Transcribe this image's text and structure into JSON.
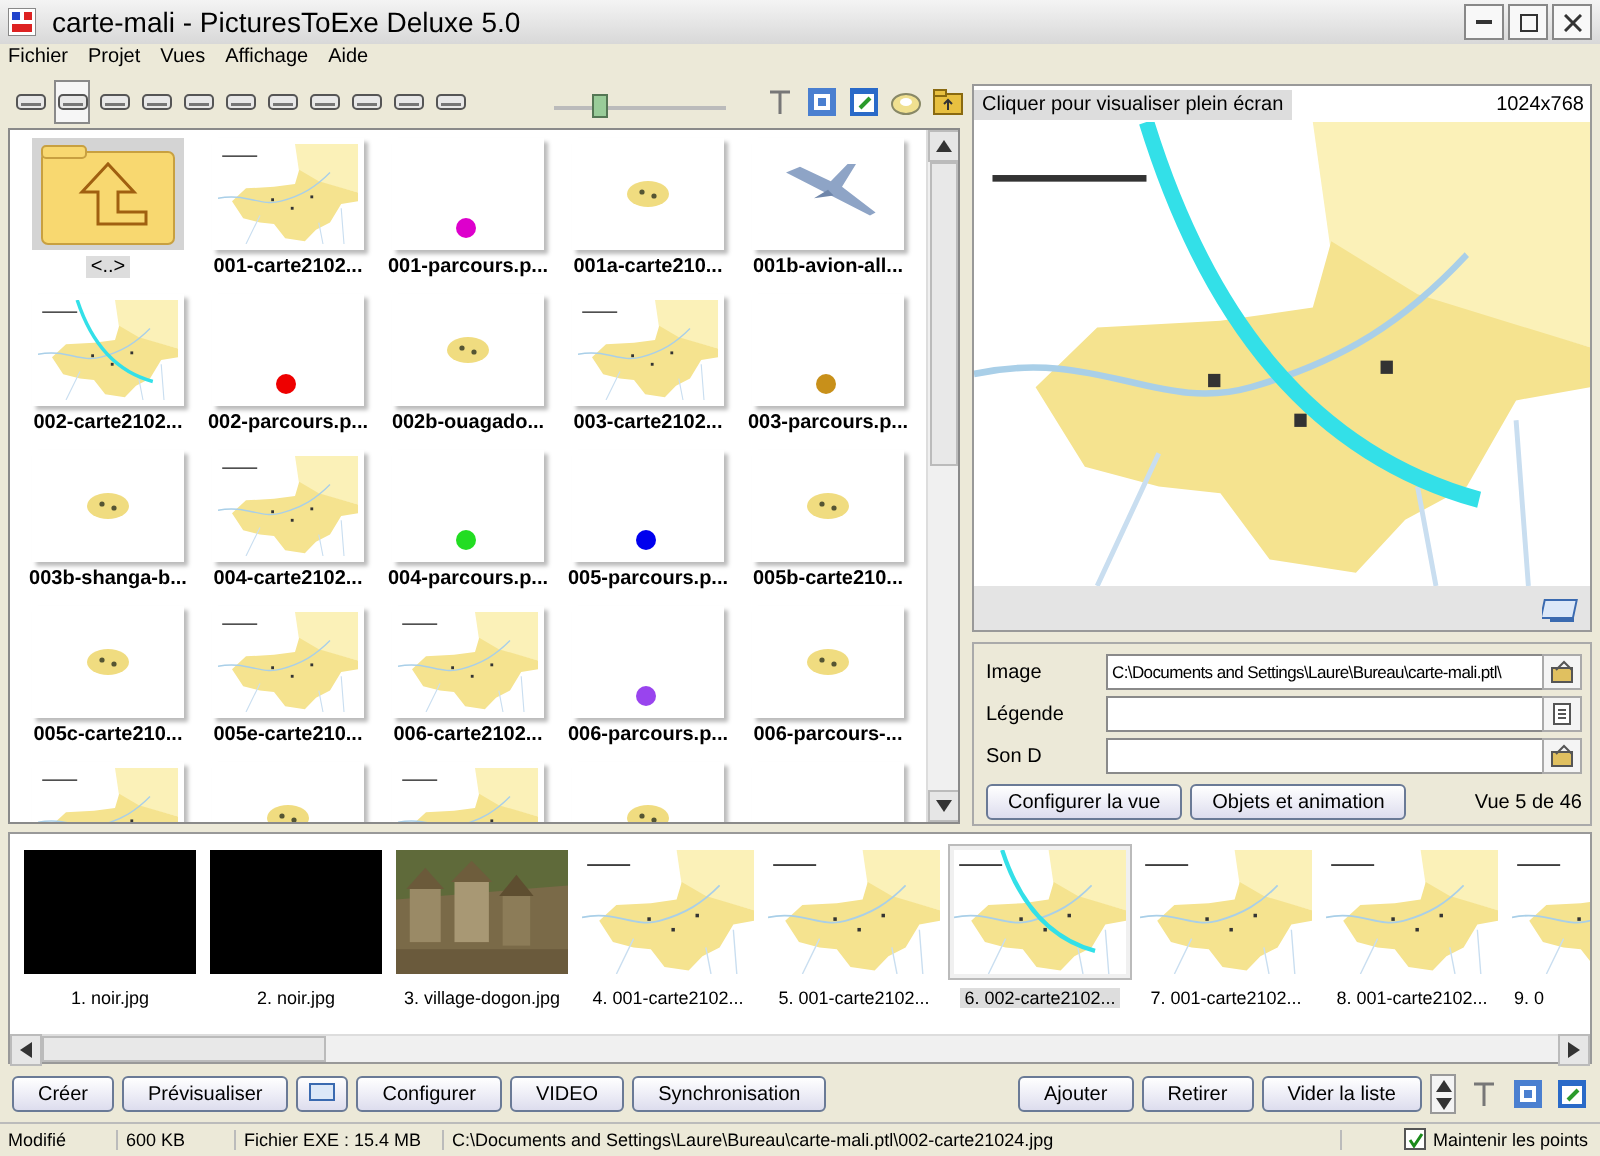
{
  "window": {
    "title": "carte-mali - PicturesToExe Deluxe 5.0"
  },
  "menu": [
    "Fichier",
    "Projet",
    "Vues",
    "Affichage",
    "Aide"
  ],
  "toolbar": {
    "drives": [
      {
        "selected": false
      },
      {
        "selected": true
      },
      {
        "selected": false
      },
      {
        "selected": false
      },
      {
        "selected": false
      },
      {
        "selected": false
      },
      {
        "selected": false
      },
      {
        "selected": false
      },
      {
        "selected": false
      },
      {
        "selected": false
      },
      {
        "selected": false
      }
    ],
    "zoom_slider": {
      "level": 0.22
    }
  },
  "browser": {
    "items": [
      {
        "kind": "folder",
        "label": "<..>",
        "selected": true
      },
      {
        "kind": "map",
        "label": "001-carte2102...",
        "selected": false
      },
      {
        "kind": "dot",
        "label": "001-parcours.p...",
        "color": "#dd00cc",
        "selected": false
      },
      {
        "kind": "small",
        "label": "001a-carte210...",
        "selected": false
      },
      {
        "kind": "plane",
        "label": "001b-avion-all...",
        "selected": false
      },
      {
        "kind": "arcmap",
        "label": "002-carte2102...",
        "selected": false
      },
      {
        "kind": "dot",
        "label": "002-parcours.p...",
        "color": "#ee0000",
        "selected": false
      },
      {
        "kind": "small",
        "label": "002b-ouagado...",
        "selected": false
      },
      {
        "kind": "map",
        "label": "003-carte2102...",
        "selected": false
      },
      {
        "kind": "dot",
        "label": "003-parcours.p...",
        "color": "#c8901a",
        "selected": false
      },
      {
        "kind": "small",
        "label": "003b-shanga-b...",
        "selected": false
      },
      {
        "kind": "map",
        "label": "004-carte2102...",
        "selected": false
      },
      {
        "kind": "dot",
        "label": "004-parcours.p...",
        "color": "#22dd22",
        "selected": false
      },
      {
        "kind": "dot",
        "label": "005-parcours.p...",
        "color": "#0000ee",
        "selected": false
      },
      {
        "kind": "small",
        "label": "005b-carte210...",
        "selected": false
      },
      {
        "kind": "small",
        "label": "005c-carte210...",
        "selected": false
      },
      {
        "kind": "map",
        "label": "005e-carte210...",
        "selected": false
      },
      {
        "kind": "map",
        "label": "006-carte2102...",
        "selected": false
      },
      {
        "kind": "dot",
        "label": "006-parcours.p...",
        "color": "#9944ee",
        "selected": false
      },
      {
        "kind": "small",
        "label": "006-parcours-...",
        "selected": false
      },
      {
        "kind": "map",
        "selected": false
      },
      {
        "kind": "small",
        "selected": false
      },
      {
        "kind": "map",
        "selected": false
      },
      {
        "kind": "small",
        "selected": false
      },
      {
        "kind": "blank",
        "selected": false
      }
    ]
  },
  "preview": {
    "hint": "Cliquer pour visualiser plein écran",
    "resolution": "1024x768"
  },
  "properties": {
    "fields": [
      {
        "label": "Image",
        "value": "C:\\Documents and Settings\\Laure\\Bureau\\carte-mali.ptl\\",
        "kind": "file"
      },
      {
        "label": "Légende",
        "kind": "caption"
      },
      {
        "label": "Son D",
        "kind": "file"
      }
    ],
    "buttons": [
      "Configurer la vue",
      "Objets et animation"
    ],
    "counter": "Vue 5 de 46"
  },
  "strip": {
    "items": [
      {
        "kind": "black",
        "label": "1. noir.jpg",
        "selected": false
      },
      {
        "kind": "black",
        "label": "2. noir.jpg",
        "selected": false
      },
      {
        "label": "3. village-dogon.jpg",
        "selected": false
      },
      {
        "kind": "map",
        "label": "4. 001-carte2102...",
        "selected": false
      },
      {
        "kind": "map",
        "label": "5. 001-carte2102...",
        "selected": false
      },
      {
        "kind": "arcmap",
        "label": "6. 002-carte2102...",
        "selected": true
      },
      {
        "kind": "map",
        "label": "7. 001-carte2102...",
        "selected": false
      },
      {
        "kind": "map",
        "label": "8. 001-carte2102...",
        "selected": false
      },
      {
        "kind": "map",
        "label": "9. 0",
        "selected": false
      }
    ]
  },
  "actions": {
    "left": [
      {
        "kind": "text",
        "label": "Créer"
      },
      {
        "kind": "text",
        "label": "Prévisualiser"
      },
      {
        "kind": "icon"
      },
      {
        "kind": "text",
        "label": "Configurer"
      },
      {
        "kind": "text",
        "label": "VIDEO"
      },
      {
        "kind": "text",
        "label": "Synchronisation"
      }
    ],
    "right": [
      "Ajouter",
      "Retirer",
      "Vider la liste"
    ]
  },
  "status_bar": {
    "state": "Modifié",
    "size": "600 KB",
    "exe": "Fichier EXE : 15.4 MB",
    "path": "C:\\Documents and Settings\\Laure\\Bureau\\carte-mali.ptl\\002-carte21024.jpg",
    "keep_points": {
      "label": "Maintenir les points",
      "checked": true
    }
  }
}
